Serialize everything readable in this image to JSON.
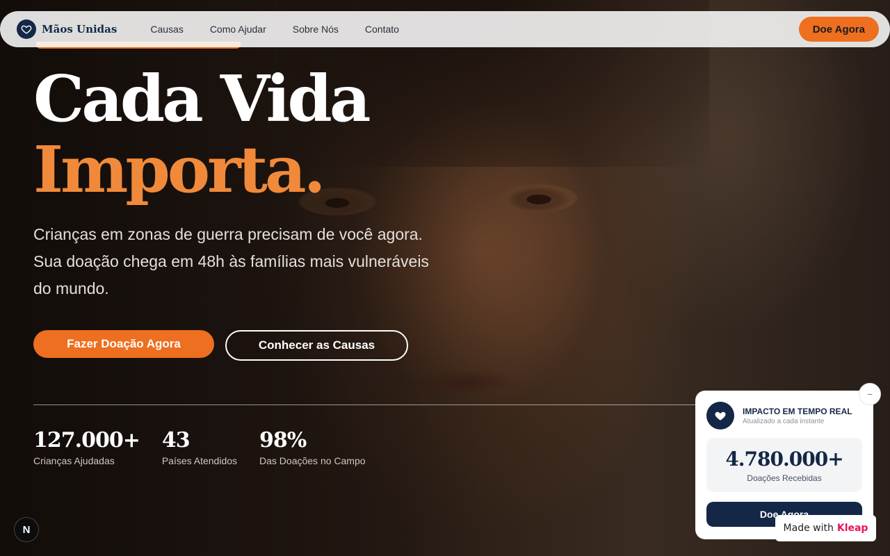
{
  "nav": {
    "brand": "Mãos Unidas",
    "links": [
      "Causas",
      "Como Ajudar",
      "Sobre Nós",
      "Contato"
    ],
    "cta": "Doe Agora"
  },
  "hero": {
    "headline_line1": "Cada Vida",
    "headline_line2": "Importa.",
    "subtitle": "Crianças em zonas de guerra precisam de você agora. Sua doação chega em 48h às famílias mais vulneráveis do mundo.",
    "primary_button": "Fazer Doação Agora",
    "secondary_button": "Conhecer as Causas"
  },
  "stats": [
    {
      "value": "127.000+",
      "label": "Crianças Ajudadas"
    },
    {
      "value": "43",
      "label": "Países Atendidos"
    },
    {
      "value": "98%",
      "label": "Das Doações no Campo"
    }
  ],
  "widget": {
    "title": "IMPACTO EM TEMPO REAL",
    "subtitle": "Atualizado a cada instante",
    "value": "4.780.000+",
    "value_label": "Doações Recebidas",
    "button": "Doe Agora",
    "close": "−"
  },
  "badge": {
    "prefix": "Made with",
    "brand": "Kleap"
  },
  "dev_badge": "N",
  "colors": {
    "accent": "#ee6f1f",
    "navy": "#142746",
    "headline_orange": "#f08a3a",
    "kleap": "#e8145a"
  },
  "icons": {
    "logo": "heart-icon",
    "widget": "heart-icon"
  }
}
